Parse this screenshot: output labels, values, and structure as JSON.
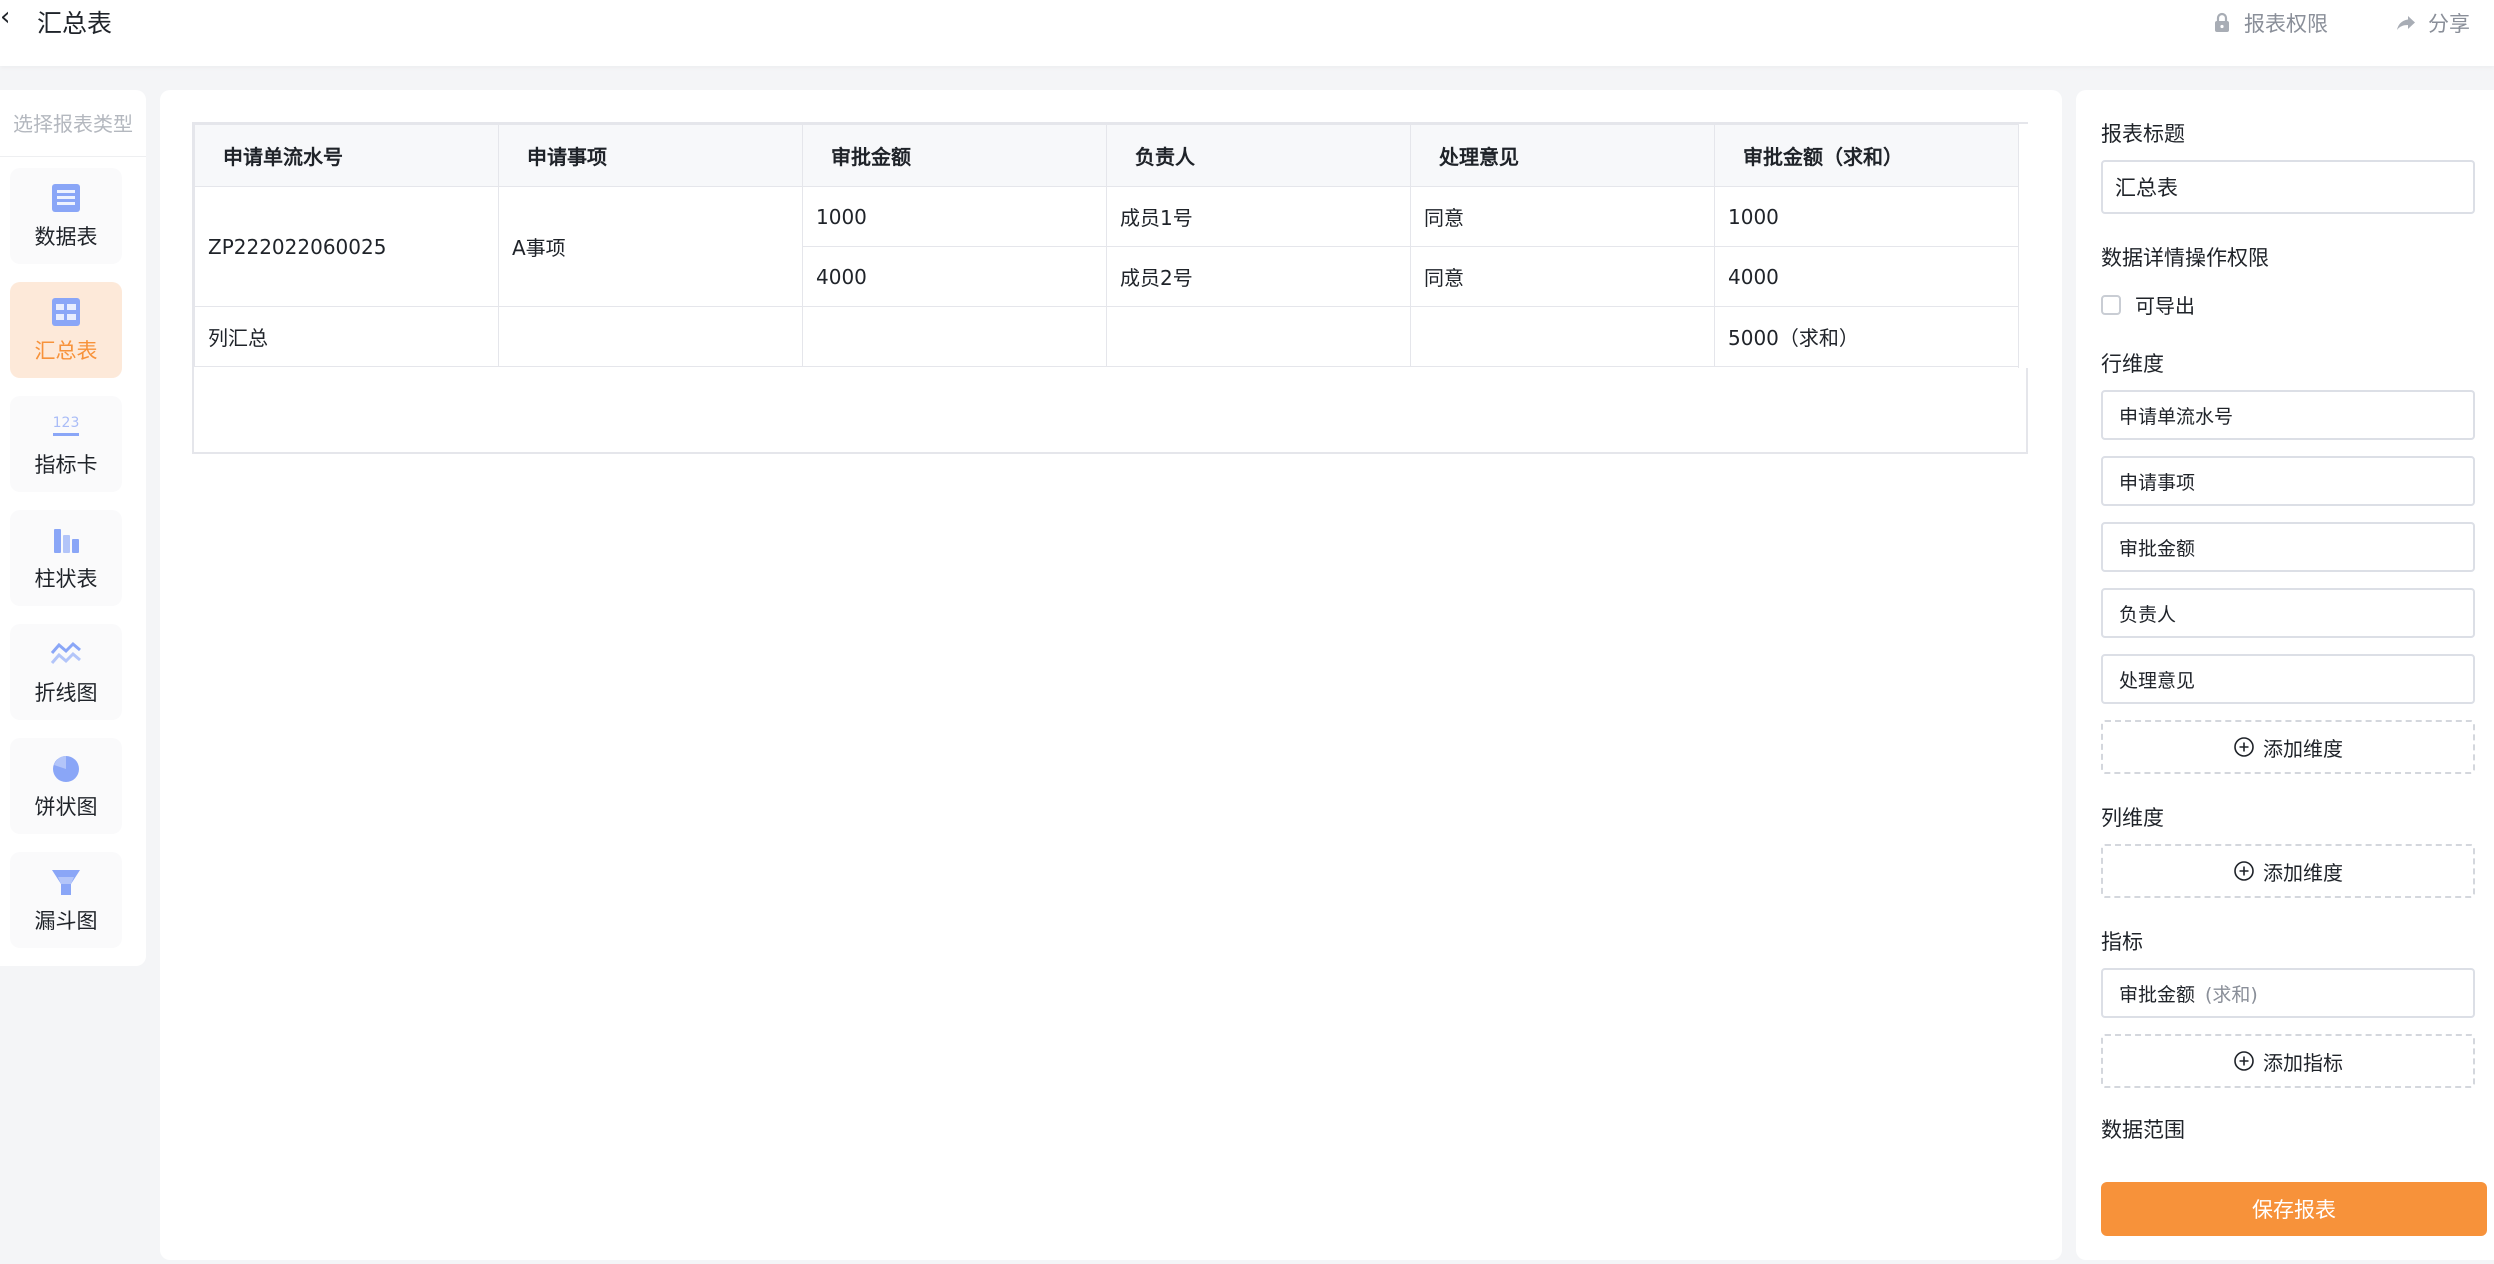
{
  "header": {
    "back_glyph": "‹",
    "title": "汇总表",
    "permission_label": "报表权限",
    "share_label": "分享"
  },
  "sidebar": {
    "header": "选择报表类型",
    "items": [
      {
        "label": "数据表",
        "icon": "data-table-icon"
      },
      {
        "label": "汇总表",
        "icon": "summary-table-icon",
        "active": true
      },
      {
        "label": "指标卡",
        "icon": "metric-card-icon"
      },
      {
        "label": "柱状表",
        "icon": "bar-chart-icon"
      },
      {
        "label": "折线图",
        "icon": "line-chart-icon"
      },
      {
        "label": "饼状图",
        "icon": "pie-chart-icon"
      },
      {
        "label": "漏斗图",
        "icon": "funnel-chart-icon"
      }
    ]
  },
  "table": {
    "headers": [
      "申请单流水号",
      "申请事项",
      "审批金额",
      "负责人",
      "处理意见",
      "审批金额（求和）"
    ],
    "group": {
      "serial": "ZP222022060025",
      "item": "A事项"
    },
    "rows": [
      {
        "amount": "1000",
        "owner": "成员1号",
        "opinion": "同意",
        "sum": "1000"
      },
      {
        "amount": "4000",
        "owner": "成员2号",
        "opinion": "同意",
        "sum": "4000"
      }
    ],
    "total": {
      "label": "列汇总",
      "sum": "5000（求和）"
    }
  },
  "panel": {
    "title_label": "报表标题",
    "title_value": "汇总表",
    "perm_label": "数据详情操作权限",
    "export_label": "可导出",
    "row_dim_label": "行维度",
    "row_dims": [
      "申请单流水号",
      "申请事项",
      "审批金额",
      "负责人",
      "处理意见"
    ],
    "add_dim_label": "添加维度",
    "col_dim_label": "列维度",
    "metric_label": "指标",
    "metric_name": "审批金额",
    "metric_agg": "(求和)",
    "add_metric_label": "添加指标",
    "range_label": "数据范围",
    "save_label": "保存报表"
  },
  "colors": {
    "accent": "#f7923a",
    "accent_bg": "#fde9d9",
    "icon_blue": "#7b9cf5"
  }
}
